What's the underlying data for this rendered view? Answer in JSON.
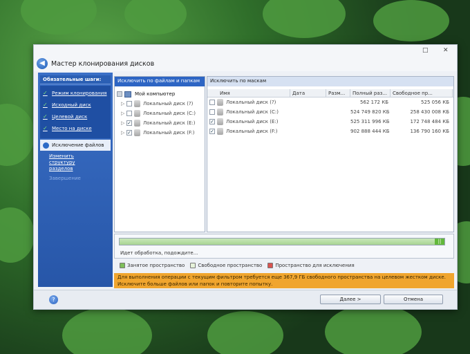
{
  "window": {
    "title": "Мастер клонирования дисков",
    "controls": {
      "maximize": "□",
      "close": "✕"
    },
    "back_glyph": "◀"
  },
  "sidebar": {
    "heading": "Обязательные шаги:",
    "steps_done": [
      {
        "label": "Режим клонирования"
      },
      {
        "label": "Исходный диск"
      },
      {
        "label": "Целевой диск"
      },
      {
        "label": "Место на диске"
      }
    ],
    "current_step": "Исключение файлов",
    "substep": "Изменить структуру разделов",
    "disabled_step": "Завершение",
    "check_glyph": "✓"
  },
  "tree": {
    "tab": "Исключить по файлам и папкам",
    "root": "Мой компьютер",
    "items": [
      {
        "label": "Локальный диск (?)",
        "checked": false
      },
      {
        "label": "Локальный диск (C:)",
        "checked": false
      },
      {
        "label": "Локальный диск (E:)",
        "checked": true
      },
      {
        "label": "Локальный диск (F:)",
        "checked": true
      }
    ]
  },
  "masks": {
    "tab": "Исключить по маскам",
    "columns": [
      "Имя",
      "Дата",
      "Разм...",
      "Полный раз...",
      "Свободное пр..."
    ],
    "rows": [
      {
        "name": "Локальный диск (?)",
        "date": "",
        "size": "",
        "total": "562 172 КБ",
        "free": "525 056 КБ",
        "checked": false
      },
      {
        "name": "Локальный диск (C:)",
        "date": "",
        "size": "",
        "total": "524 749 820 КБ",
        "free": "258 430 008 КБ",
        "checked": false
      },
      {
        "name": "Локальный диск (E:)",
        "date": "",
        "size": "",
        "total": "525 311 996 КБ",
        "free": "172 748 484 КБ",
        "checked": true
      },
      {
        "name": "Локальный диск (F:)",
        "date": "",
        "size": "",
        "total": "902 888 444 КБ",
        "free": "136 790 160 КБ",
        "checked": true
      }
    ]
  },
  "progress": {
    "status": "Идет обработка, подождите...",
    "fill_fraction": 0.97
  },
  "legend": [
    {
      "label": "Занятое пространство",
      "color": "#7fbf5a"
    },
    {
      "label": "Свободное пространство",
      "color": "#e6f2d9"
    },
    {
      "label": "Пространство для исключения",
      "color": "#d9534f"
    }
  ],
  "warning": {
    "line1": "Для выполнения операции с текущим фильтром требуется еще 367,9 ГБ свободного пространства на целевом жестком диске.",
    "line2": "Исключите больше файлов или папок и повторите попытку."
  },
  "footer": {
    "help": "?",
    "next": "Далее >",
    "cancel": "Отмена"
  },
  "colors": {
    "accent": "#2d65c4",
    "warning": "#f0a52e",
    "sidebar": "#2756a8"
  }
}
